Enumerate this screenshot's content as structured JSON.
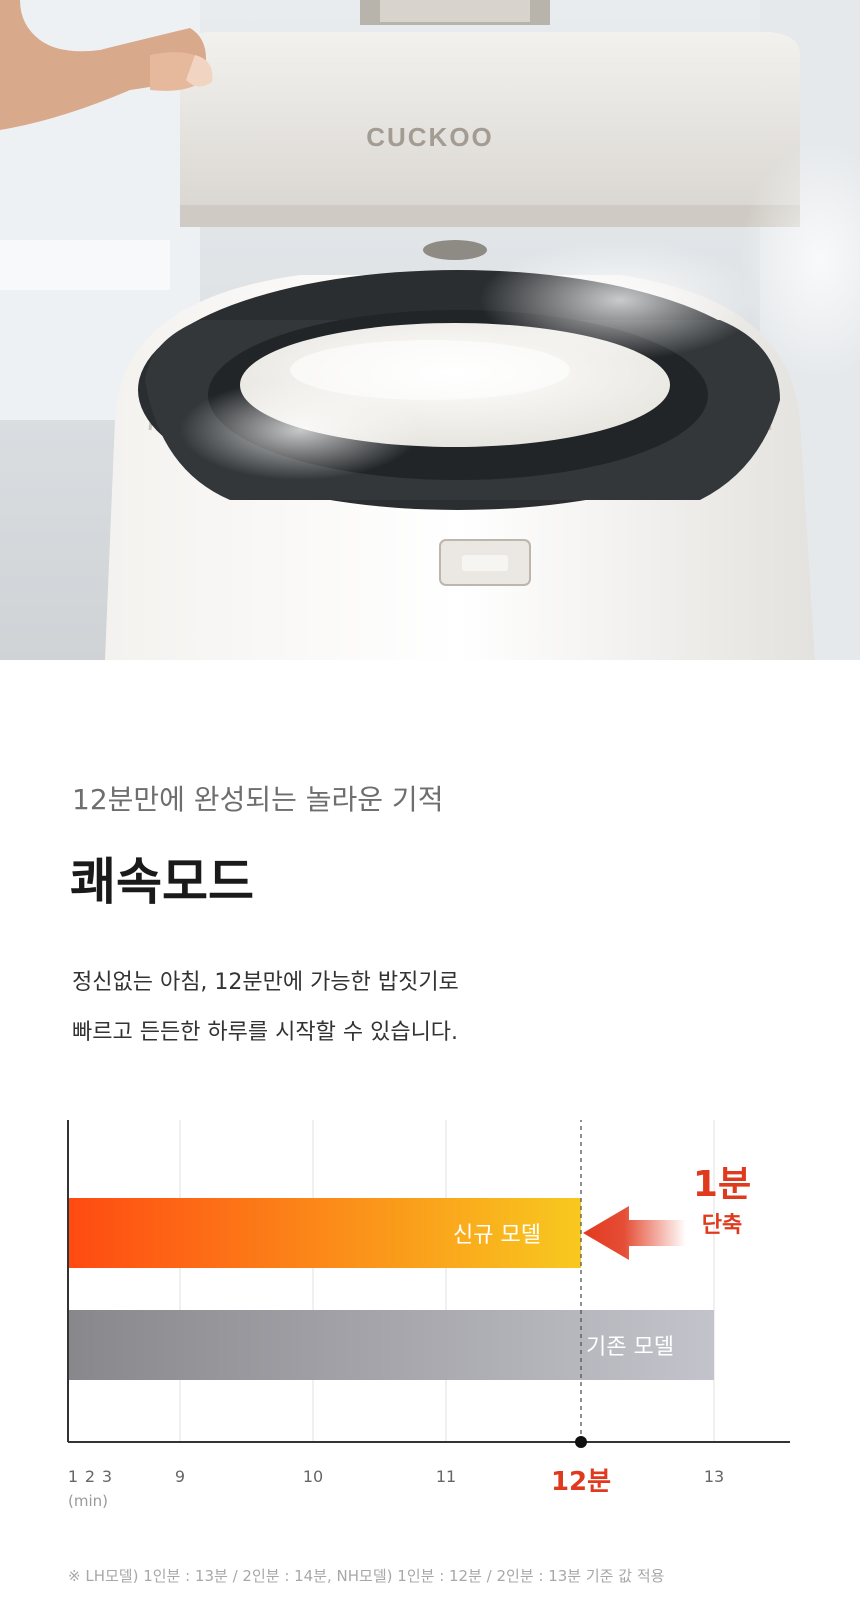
{
  "hero": {
    "logo_text": "CUCKOO"
  },
  "intro": {
    "eyebrow": "12분만에 완성되는 놀라운 기적",
    "title": "쾌속모드",
    "description_lines": [
      "정신없는 아침, 12분만에 가능한 밥짓기로",
      "빠르고 든든한 하루를 시작할 수 있습니다."
    ]
  },
  "chart_data": {
    "type": "bar",
    "orientation": "horizontal",
    "x_unit": "(min)",
    "x_tick_labels": [
      "1",
      "2",
      "3",
      "9",
      "10",
      "11",
      "12분",
      "13"
    ],
    "x_ticks": [
      1,
      2,
      3,
      9,
      10,
      11,
      12,
      13
    ],
    "axis_break": "3 to 9 compressed",
    "grid": true,
    "series": [
      {
        "name": "신규 모델",
        "value": 12,
        "color_start": "#ff4a12",
        "color_end": "#f8c91f"
      },
      {
        "name": "기존 모델",
        "value": 13,
        "color_start": "#88888c",
        "color_end": "#c3c3cb"
      }
    ],
    "highlight": {
      "value": 12,
      "label": "12분",
      "color": "#e03a1e",
      "annotation_main": "1분",
      "annotation_sub": "단축"
    }
  },
  "footnote": "※ LH모델) 1인분 : 13분 / 2인분 : 14분, NH모델) 1인분 : 12분 / 2인분 : 13분 기준 값 적용"
}
